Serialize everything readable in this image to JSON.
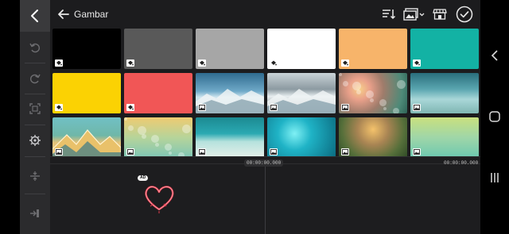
{
  "header": {
    "title": "Gambar"
  },
  "icons": {
    "back": "chevron-left-icon",
    "sort": "sort-icon",
    "media_filter": "image-filter-icon",
    "store": "store-icon",
    "confirm": "check-circle-icon"
  },
  "tiles": [
    {
      "kind": "color",
      "color": "#000000",
      "badge": "paint-bucket-icon"
    },
    {
      "kind": "color",
      "color": "#595959",
      "badge": "paint-bucket-icon"
    },
    {
      "kind": "color",
      "color": "#a6a6a6",
      "badge": "paint-bucket-icon"
    },
    {
      "kind": "color",
      "color": "#ffffff",
      "badge": "paint-bucket-icon"
    },
    {
      "kind": "color",
      "color": "#f7b46a",
      "badge": "paint-bucket-icon"
    },
    {
      "kind": "color",
      "color": "#13b2a4",
      "badge": "paint-bucket-icon"
    },
    {
      "kind": "color",
      "color": "#fbd203",
      "badge": "paint-bucket-icon"
    },
    {
      "kind": "color",
      "color": "#f15656",
      "badge": "paint-bucket-icon"
    },
    {
      "kind": "image",
      "badge": "image-icon"
    },
    {
      "kind": "image",
      "badge": "image-icon"
    },
    {
      "kind": "image",
      "badge": "image-icon"
    },
    {
      "kind": "image",
      "badge": "image-icon"
    },
    {
      "kind": "image",
      "badge": "image-icon"
    },
    {
      "kind": "image",
      "badge": "image-icon"
    },
    {
      "kind": "image",
      "badge": "image-icon"
    },
    {
      "kind": "image",
      "badge": "image-icon"
    },
    {
      "kind": "image",
      "badge": "image-icon"
    },
    {
      "kind": "image",
      "badge": "image-icon"
    }
  ],
  "timeline": {
    "timecode_playhead": "00:00:00.000",
    "timecode_end": "00:00:00.000",
    "ad_badge": "AD"
  },
  "colors": {
    "accent": "#e33b4c",
    "panel": "#1c1c1e",
    "rail": "#2b2b2d"
  }
}
